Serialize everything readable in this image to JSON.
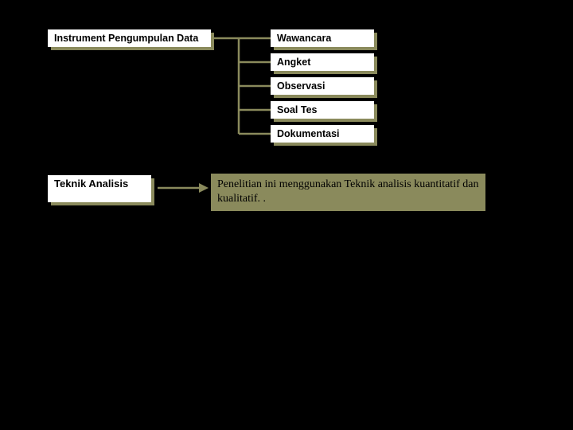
{
  "section1": {
    "title": "Instrument Pengumpulan Data",
    "items": [
      "Wawancara",
      "Angket",
      "Observasi",
      "Soal Tes",
      "Dokumentasi"
    ]
  },
  "section2": {
    "title": "Teknik Analisis",
    "description": "Penelitian ini menggunakan Teknik analisis kuantitatif dan kualitatif. ."
  }
}
